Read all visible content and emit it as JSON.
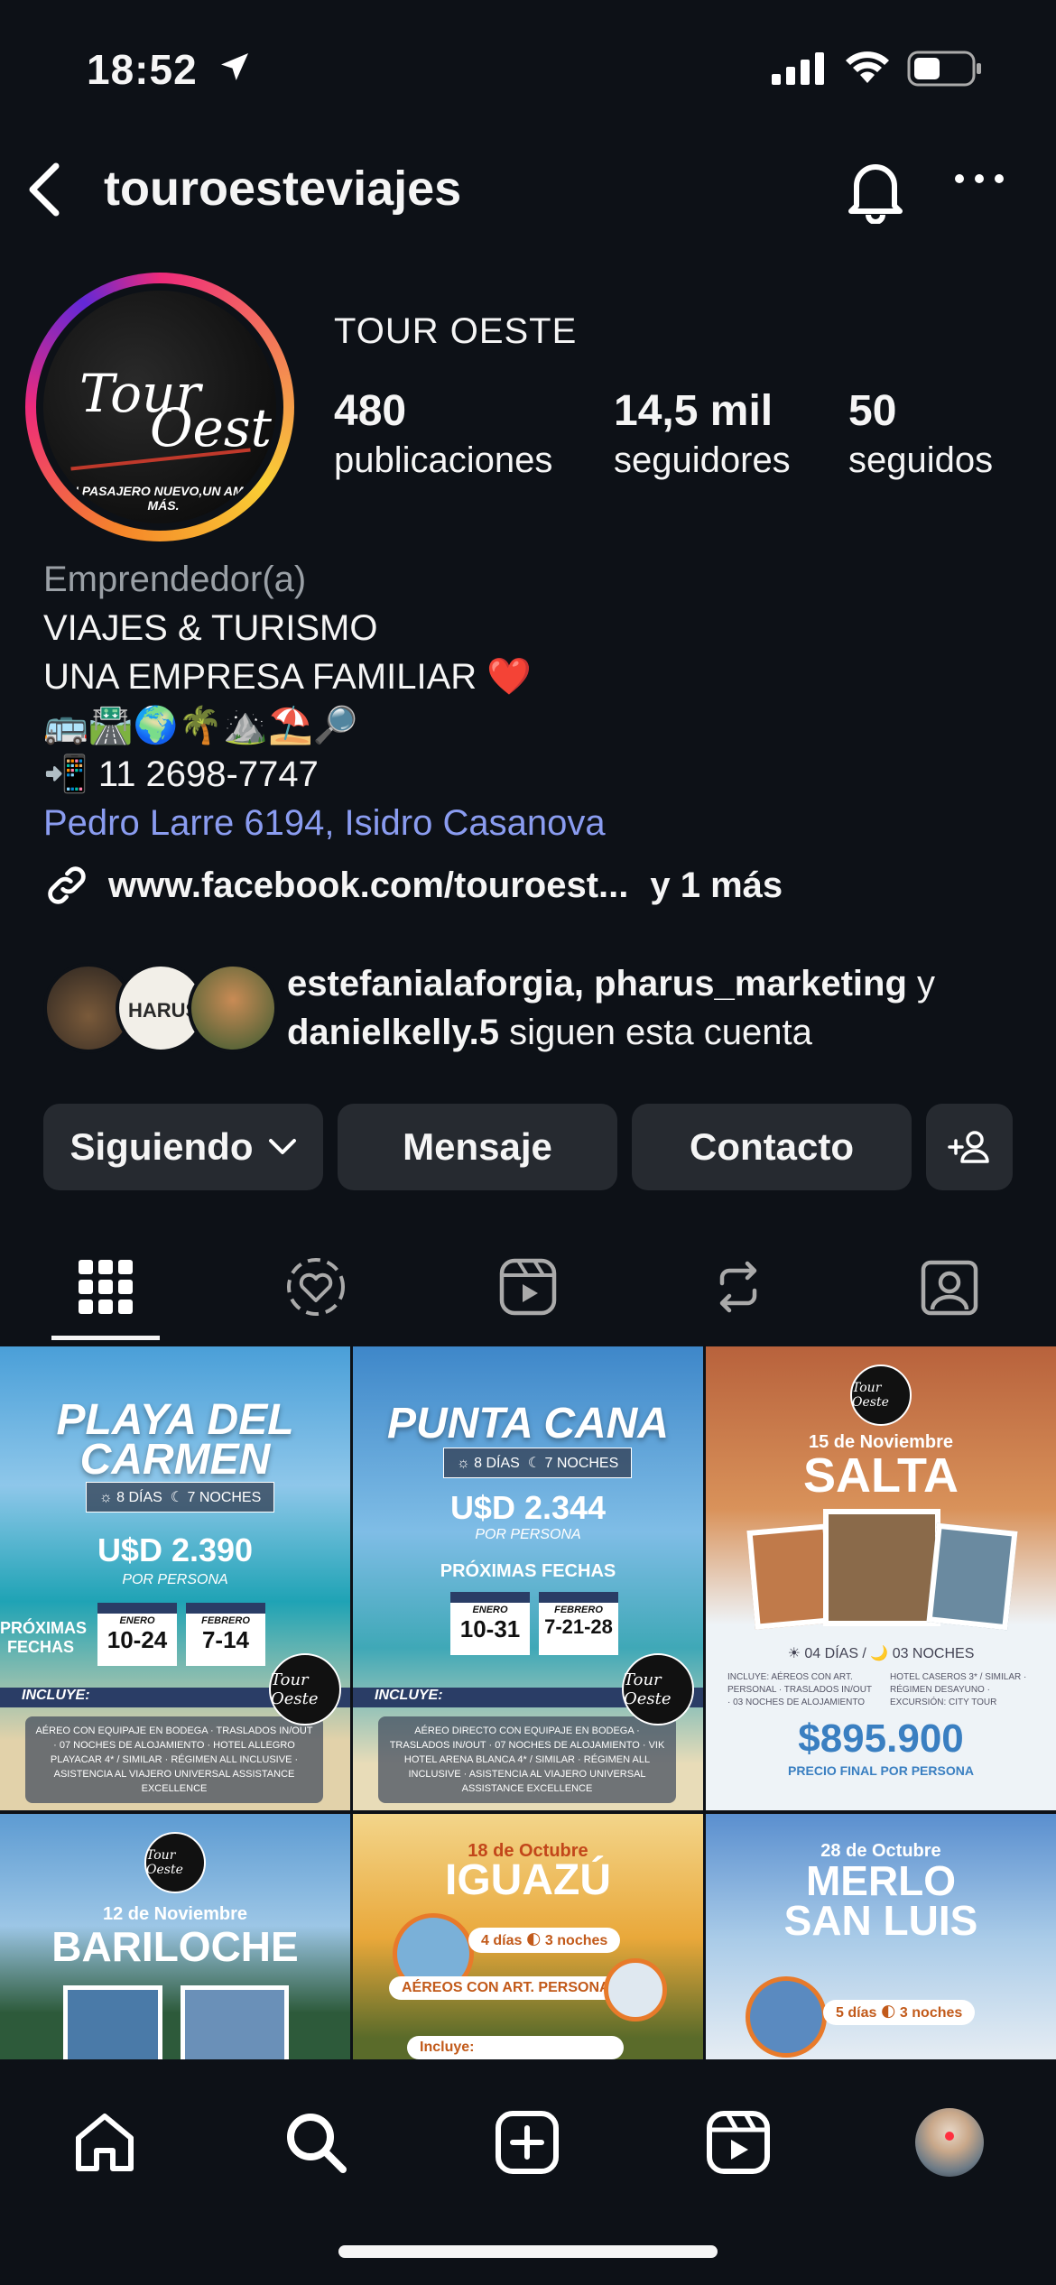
{
  "status_bar": {
    "time": "18:52"
  },
  "header": {
    "username": "touroesteviajes"
  },
  "profile": {
    "display_name": "TOUR OESTE",
    "avatar_logo_top": "Tour",
    "avatar_logo_bottom": "Oeste",
    "avatar_tagline": "UN PASAJERO NUEVO,UN AMIGO MÁS.",
    "stats": [
      {
        "value": "480",
        "label": "publicaciones"
      },
      {
        "value": "14,5 mil",
        "label": "seguidores"
      },
      {
        "value": "50",
        "label": "seguidos"
      }
    ],
    "bio": {
      "category": "Emprendedor(a)",
      "line1": "VIAJES & TURISMO",
      "line2": "UNA EMPRESA FAMILIAR ❤️",
      "emojis": "🚌🛣️🌍🌴⛰️⛱️🔎",
      "phone": "📲 11 2698-7747",
      "address": "Pedro Larre 6194, Isidro Casanova"
    },
    "link": {
      "url": "www.facebook.com/touroest...",
      "more": "y 1 más"
    },
    "mutuals": {
      "avatar2_text": "HARUS",
      "names_a": "estefanialaforgia, pharus_marketing",
      "conj": " y ",
      "names_b": "danielkelly.5",
      "suffix": " siguen esta cuenta"
    }
  },
  "buttons": {
    "following": "Siguiendo",
    "message": "Mensaje",
    "contact": "Contacto"
  },
  "posts": [
    {
      "title": "PLAYA DEL CARMEN",
      "chip_days": "☼ 8 DÍAS",
      "chip_nights": "☾ 7 NOCHES",
      "price": "U$D 2.390",
      "per": "POR PERSONA",
      "dates_label": "PRÓXIMAS FECHAS",
      "date1_month": "ENERO",
      "date1": "10-24",
      "date2_month": "FEBRERO",
      "date2": "7-14",
      "includes": "INCLUYE:",
      "list": "AÉREO CON EQUIPAJE EN BODEGA · TRASLADOS IN/OUT · 07 NOCHES DE ALOJAMIENTO · HOTEL ALLEGRO PLAYACAR 4* / SIMILAR · RÉGIMEN ALL INCLUSIVE · ASISTENCIA AL VIAJERO UNIVERSAL ASSISTANCE EXCELLENCE"
    },
    {
      "title": "PUNTA CANA",
      "chip_days": "☼ 8 DÍAS",
      "chip_nights": "☾ 7 NOCHES",
      "price": "U$D 2.344",
      "per": "POR PERSONA",
      "dates_label": "PRÓXIMAS FECHAS",
      "date1_month": "ENERO",
      "date1": "10-31",
      "date2_month": "FEBRERO",
      "date2": "7-21-28",
      "includes": "INCLUYE:",
      "list": "AÉREO DIRECTO CON EQUIPAJE EN BODEGA · TRASLADOS IN/OUT · 07 NOCHES DE ALOJAMIENTO · VIK HOTEL ARENA BLANCA 4* / SIMILAR · RÉGIMEN ALL INCLUSIVE · ASISTENCIA AL VIAJERO UNIVERSAL ASSISTANCE EXCELLENCE"
    },
    {
      "date": "15 de Noviembre",
      "title": "SALTA",
      "days": "☀ 04 DÍAS / 🌙 03 NOCHES",
      "detail_left": "INCLUYE: AÉREOS CON ART. PERSONAL · TRASLADOS IN/OUT · 03 NOCHES DE ALOJAMIENTO",
      "detail_right": "HOTEL CASEROS 3* / SIMILAR · RÉGIMEN DESAYUNO · EXCURSIÓN: CITY TOUR",
      "price": "$895.900",
      "note": "PRECIO FINAL POR PERSONA"
    },
    {
      "date": "12 de Noviembre",
      "title": "BARILOCHE"
    },
    {
      "date": "18 de Octubre",
      "title": "IGUAZÚ",
      "pill1": "4 días 🌓 3 noches",
      "pill2": "AÉREOS CON ART. PERSONAL",
      "pill3": "Incluye:"
    },
    {
      "date": "28 de Octubre",
      "title": "MERLO SAN LUIS",
      "pill1": "5 días 🌓 3 noches"
    }
  ],
  "badge_text": "Tour Oeste"
}
